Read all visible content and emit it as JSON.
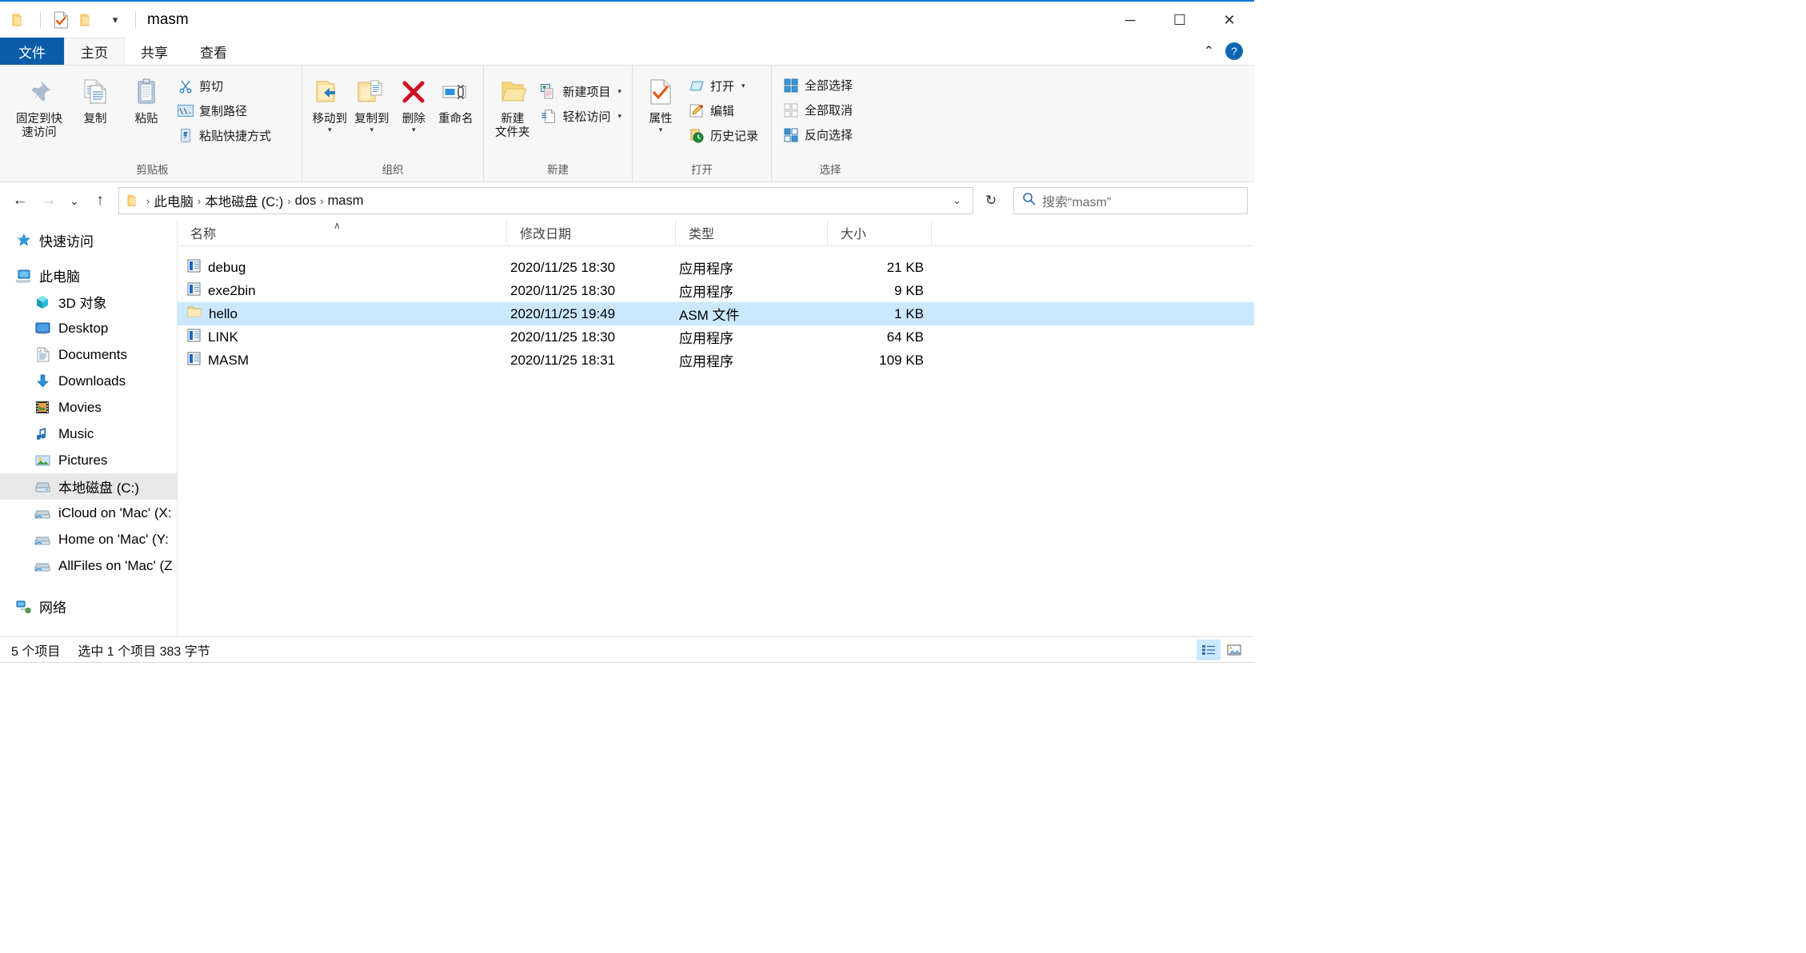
{
  "window": {
    "title": "masm",
    "minimize_label": "─",
    "maximize_label": "☐",
    "close_label": "✕"
  },
  "quick_access_toolbar": {
    "items": [
      {
        "name": "folder-icon",
        "label": ""
      },
      {
        "name": "properties-check-icon",
        "label": ""
      },
      {
        "name": "new-folder-icon",
        "label": ""
      },
      {
        "name": "customize-caret-icon",
        "label": "▾"
      }
    ]
  },
  "tabs": [
    {
      "id": "file",
      "label": "文件"
    },
    {
      "id": "home",
      "label": "主页"
    },
    {
      "id": "share",
      "label": "共享"
    },
    {
      "id": "view",
      "label": "查看"
    }
  ],
  "tabstrip_right": {
    "collapse_label": "⌃",
    "help_label": "?"
  },
  "ribbon": {
    "groups": [
      {
        "id": "clipboard",
        "label": "剪贴板",
        "big_buttons": [
          {
            "id": "pin-to-quick-access",
            "label": "固定到快\n速访问",
            "icon": "pin-icon"
          },
          {
            "id": "copy",
            "label": "复制",
            "icon": "copy-icon"
          },
          {
            "id": "paste",
            "label": "粘贴",
            "icon": "paste-icon"
          }
        ],
        "small_buttons": [
          {
            "id": "cut",
            "label": "剪切",
            "icon": "scissors-icon"
          },
          {
            "id": "copy-path",
            "label": "复制路径",
            "icon": "copy-path-icon"
          },
          {
            "id": "paste-shortcut",
            "label": "粘贴快捷方式",
            "icon": "paste-shortcut-icon"
          }
        ]
      },
      {
        "id": "organize",
        "label": "组织",
        "big_buttons": [
          {
            "id": "move-to",
            "label": "移动到",
            "icon": "move-to-icon",
            "caret": "▾"
          },
          {
            "id": "copy-to",
            "label": "复制到",
            "icon": "copy-to-icon",
            "caret": "▾"
          },
          {
            "id": "delete",
            "label": "删除",
            "icon": "delete-x-icon",
            "caret": "▾"
          },
          {
            "id": "rename",
            "label": "重命名",
            "icon": "rename-icon"
          }
        ],
        "small_buttons": []
      },
      {
        "id": "new",
        "label": "新建",
        "big_buttons": [
          {
            "id": "new-folder",
            "label": "新建\n文件夹",
            "icon": "new-folder-icon"
          }
        ],
        "small_buttons": [
          {
            "id": "new-item",
            "label": "新建项目",
            "icon": "new-item-icon",
            "caret": "▾"
          },
          {
            "id": "easy-access",
            "label": "轻松访问",
            "icon": "easy-access-icon",
            "caret": "▾"
          }
        ]
      },
      {
        "id": "open",
        "label": "打开",
        "big_buttons": [
          {
            "id": "properties",
            "label": "属性",
            "icon": "properties-icon",
            "caret": "▾"
          }
        ],
        "small_buttons": [
          {
            "id": "open-with",
            "label": "打开",
            "icon": "open-notepad-icon",
            "caret": "▾"
          },
          {
            "id": "edit",
            "label": "编辑",
            "icon": "edit-pencil-icon"
          },
          {
            "id": "history",
            "label": "历史记录",
            "icon": "history-icon"
          }
        ]
      },
      {
        "id": "select",
        "label": "选择",
        "big_buttons": [],
        "small_buttons": [
          {
            "id": "select-all",
            "label": "全部选择",
            "icon": "select-all-icon"
          },
          {
            "id": "select-none",
            "label": "全部取消",
            "icon": "select-none-icon"
          },
          {
            "id": "invert-selection",
            "label": "反向选择",
            "icon": "invert-selection-icon"
          }
        ]
      }
    ]
  },
  "navbar": {
    "back_label": "←",
    "forward_label": "→",
    "recent_label": "⌄",
    "up_label": "↑",
    "refresh_label": "↻",
    "address_caret": "⌄",
    "breadcrumbs": [
      {
        "label": "此电脑"
      },
      {
        "label": "本地磁盘 (C:)"
      },
      {
        "label": "dos"
      },
      {
        "label": "masm"
      }
    ],
    "separator": "›",
    "search_placeholder": "搜索“masm”",
    "search_value": "",
    "search_icon": "search-icon"
  },
  "sidebar": {
    "items": [
      {
        "id": "quick-access",
        "label": "快速访问",
        "icon": "star-pin-icon",
        "indent": false,
        "selected": false,
        "spacer_after": true
      },
      {
        "id": "this-pc",
        "label": "此电脑",
        "icon": "computer-icon",
        "indent": false,
        "selected": false
      },
      {
        "id": "3d-objects",
        "label": "3D 对象",
        "icon": "cube-icon",
        "indent": true,
        "selected": false
      },
      {
        "id": "desktop",
        "label": "Desktop",
        "icon": "desktop-icon",
        "indent": true,
        "selected": false
      },
      {
        "id": "documents",
        "label": "Documents",
        "icon": "documents-icon",
        "indent": true,
        "selected": false
      },
      {
        "id": "downloads",
        "label": "Downloads",
        "icon": "download-arrow-icon",
        "indent": true,
        "selected": false
      },
      {
        "id": "movies",
        "label": "Movies",
        "icon": "film-icon",
        "indent": true,
        "selected": false
      },
      {
        "id": "music",
        "label": "Music",
        "icon": "music-note-icon",
        "indent": true,
        "selected": false
      },
      {
        "id": "pictures",
        "label": "Pictures",
        "icon": "pictures-icon",
        "indent": true,
        "selected": false
      },
      {
        "id": "local-disk-c",
        "label": "本地磁盘 (C:)",
        "icon": "drive-icon",
        "indent": true,
        "selected": true
      },
      {
        "id": "icloud-on-mac",
        "label": "iCloud on 'Mac' (X:",
        "icon": "network-drive-icon",
        "indent": true,
        "selected": false
      },
      {
        "id": "home-on-mac",
        "label": "Home on 'Mac' (Y:",
        "icon": "network-drive-icon",
        "indent": true,
        "selected": false
      },
      {
        "id": "allfiles-on-mac",
        "label": "AllFiles on 'Mac' (Z",
        "icon": "network-drive-icon",
        "indent": true,
        "selected": false
      },
      {
        "id": "network",
        "label": "网络",
        "icon": "network-icon",
        "indent": false,
        "selected": false,
        "spacer_before": true
      }
    ]
  },
  "filelist": {
    "columns": [
      {
        "id": "name",
        "label": "名称",
        "sorted": true,
        "sort_mark": "∧"
      },
      {
        "id": "date",
        "label": "修改日期"
      },
      {
        "id": "type",
        "label": "类型"
      },
      {
        "id": "size",
        "label": "大小"
      }
    ],
    "rows": [
      {
        "name": "debug",
        "date": "2020/11/25 18:30",
        "type": "应用程序",
        "size": "21 KB",
        "icon": "app-exe-icon",
        "selected": false
      },
      {
        "name": "exe2bin",
        "date": "2020/11/25 18:30",
        "type": "应用程序",
        "size": "9 KB",
        "icon": "app-exe-icon",
        "selected": false
      },
      {
        "name": "hello",
        "date": "2020/11/25 19:49",
        "type": "ASM 文件",
        "size": "1 KB",
        "icon": "asm-file-icon",
        "selected": true
      },
      {
        "name": "LINK",
        "date": "2020/11/25 18:30",
        "type": "应用程序",
        "size": "64 KB",
        "icon": "app-exe-icon",
        "selected": false
      },
      {
        "name": "MASM",
        "date": "2020/11/25 18:31",
        "type": "应用程序",
        "size": "109 KB",
        "icon": "app-exe-icon",
        "selected": false
      }
    ]
  },
  "statusbar": {
    "item_count": "5 个项目",
    "selection_info": "选中 1 个项目  383 字节",
    "views": [
      {
        "id": "details-view",
        "icon": "details-view-icon",
        "active": true
      },
      {
        "id": "large-icons-view",
        "icon": "large-icons-view-icon",
        "active": false
      }
    ]
  }
}
